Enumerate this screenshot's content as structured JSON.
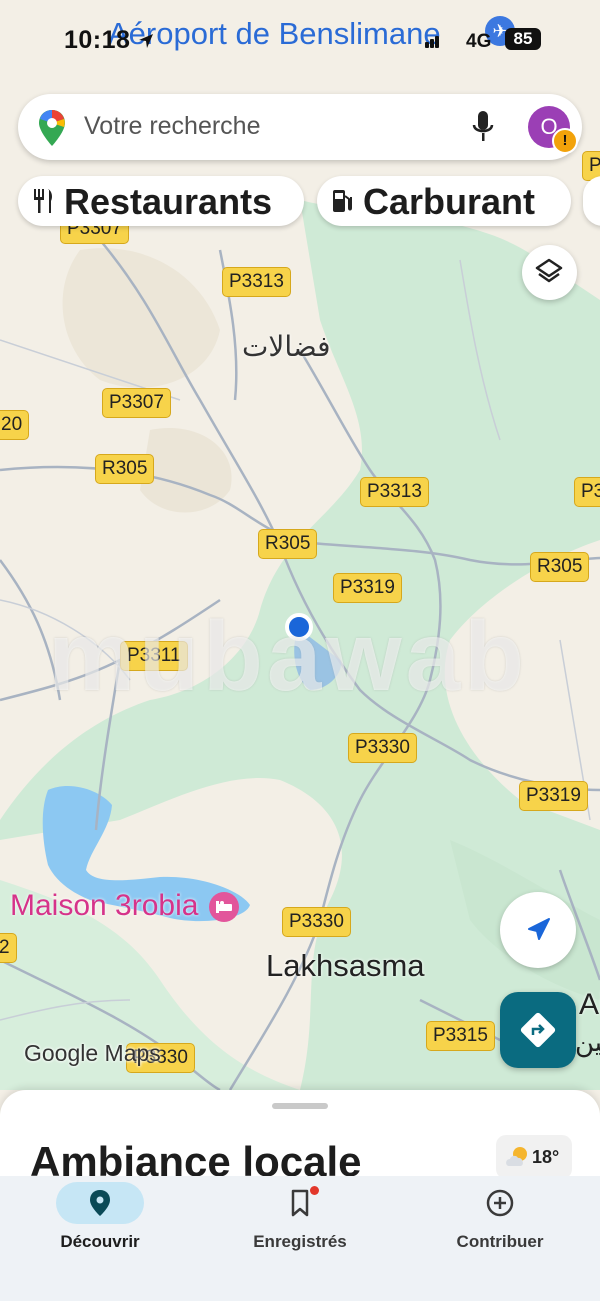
{
  "status_bar": {
    "time": "10:18",
    "network": "4G",
    "battery": "85"
  },
  "search": {
    "placeholder": "Votre recherche",
    "avatar_initial": "O"
  },
  "chips": [
    {
      "label": "Restaurants",
      "icon": "fork-knife-icon"
    },
    {
      "label": "Carburant",
      "icon": "fuel-pump-icon"
    }
  ],
  "map": {
    "airport_label": "Aéroport de Benslimane",
    "arabic_place": "فضالات",
    "poi_label": "Maison 3robia",
    "town_label": "Lakhsasma",
    "partial_label_right": "Ain",
    "partial_label_right_arabic": "عين",
    "attribution": "Google Maps",
    "watermark": "mubawab",
    "road_labels": {
      "r1": "P3307",
      "r2": "P3313",
      "r3": "P3307",
      "r4": "R305",
      "r5": "P3313",
      "r6": "R305",
      "r7": "R305",
      "r8": "P3319",
      "r9": "P3311",
      "r10": "P3330",
      "r11": "P3319",
      "r12": "P3330",
      "r13": "P3315",
      "r14": "P3330",
      "edge_left_1": "20",
      "edge_left_2": "2",
      "edge_right_1": "P",
      "edge_right_2": "P3"
    }
  },
  "sheet": {
    "title": "Ambiance locale",
    "temperature": "18°"
  },
  "nav": [
    {
      "label": "Découvrir",
      "icon": "location-pin-icon",
      "active": true
    },
    {
      "label": "Enregistrés",
      "icon": "bookmark-icon",
      "active": false
    },
    {
      "label": "Contribuer",
      "icon": "add-circle-icon",
      "active": false
    }
  ],
  "colors": {
    "map_land": "#f3efe6",
    "map_green": "#cfead6",
    "water": "#8cc8f2",
    "road_label_bg": "#f7d34a",
    "poi_pink": "#d6338a",
    "directions_button": "#0a6b80",
    "location_dot": "#1a66d9"
  }
}
